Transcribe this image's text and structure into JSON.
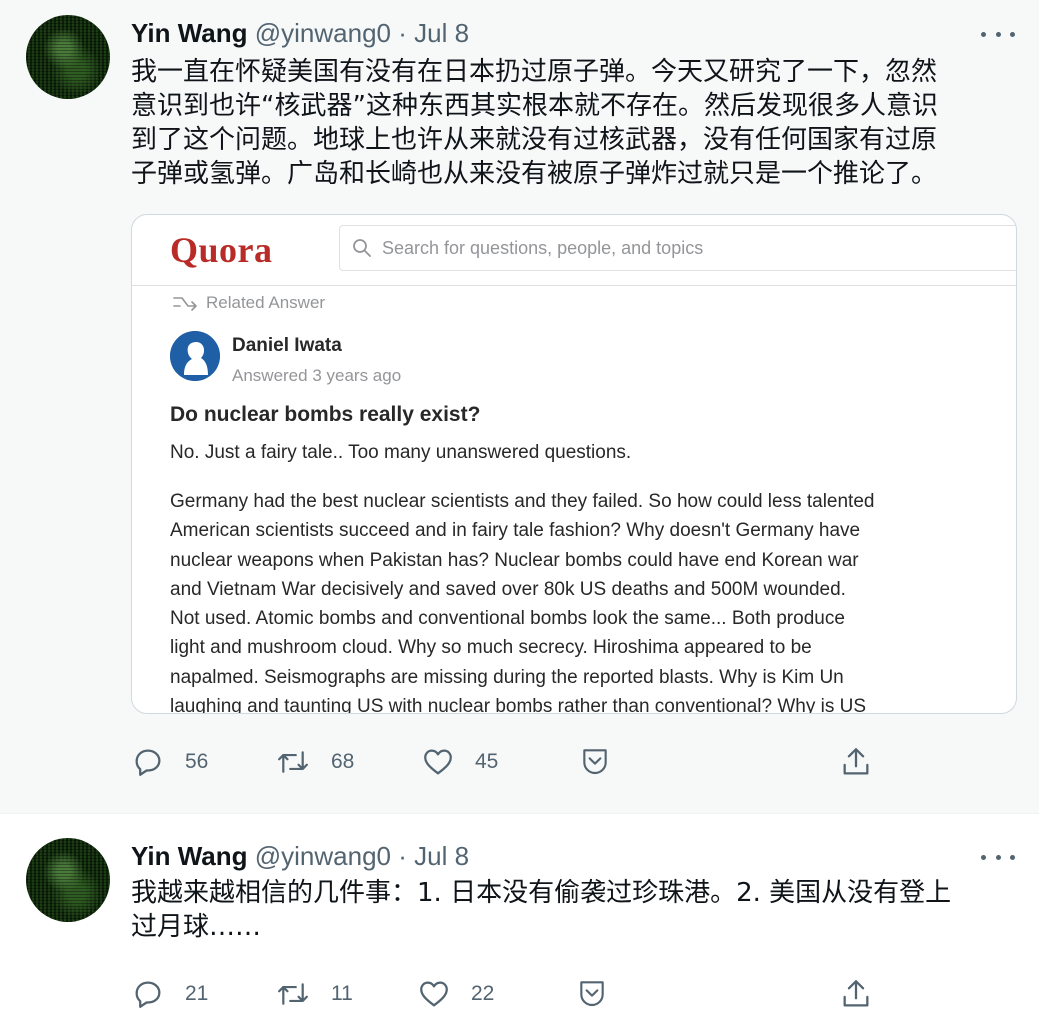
{
  "tweets": [
    {
      "author_name": "Yin Wang",
      "handle": "@yinwang0",
      "separator": "·",
      "date": "Jul 8",
      "text_lines": [
        "我一直在怀疑美国有没有在日本扔过原子弹。今天又研究了一下，忽然",
        "意识到也许“核武器”这种东西其实根本就不存在。然后发现很多人意识",
        "到了这个问题。地球上也许从来就没有过核武器，没有任何国家有过原",
        "子弹或氢弹。广岛和长崎也从来没有被原子弹炸过就只是一个推论了。"
      ],
      "card": {
        "logo": "Quora",
        "search_placeholder": "Search for questions, people, and topics",
        "related_label": "Related Answer",
        "author": "Daniel Iwata",
        "answered": "Answered 3 years ago",
        "question": "Do nuclear bombs really exist?",
        "short_answer": "No. Just a fairy tale.. Too many unanswered questions.",
        "body_lines": [
          "Germany had the best nuclear scientists and they failed. So how could less talented",
          "American scientists succeed and in fairy tale fashion? Why doesn't Germany have",
          "nuclear weapons when Pakistan has? Nuclear bombs could have end Korean war",
          "and Vietnam War decisively and saved over 80k US deaths and 500M wounded.",
          "Not used. Atomic bombs and conventional bombs look the same... Both produce",
          "light and mushroom cloud. Why so much secrecy. Hiroshima appeared to be",
          "napalmed. Seismographs are missing during the reported blasts. Why is Kim Un",
          "laughing and taunting US with nuclear bombs rather than conventional? Why is US"
        ]
      },
      "actions": {
        "replies": "56",
        "retweets": "68",
        "likes": "45"
      }
    },
    {
      "author_name": "Yin Wang",
      "handle": "@yinwang0",
      "separator": "·",
      "date": "Jul 8",
      "text_lines": [
        "我越来越相信的几件事：1. 日本没有偷袭过珍珠港。2. 美国从没有登上",
        "过月球……"
      ],
      "actions": {
        "replies": "21",
        "retweets": "11",
        "likes": "22"
      }
    }
  ],
  "icons": {
    "reply": "reply-bubble-icon",
    "retweet": "retweet-arrows-icon",
    "like": "heart-icon",
    "bookmark": "bookmark-chevron-icon",
    "share": "share-upload-icon",
    "more": "more-dots-icon"
  },
  "colors": {
    "quora_red": "#b92b27",
    "muted": "#536471",
    "card_border": "#cfd9de"
  }
}
